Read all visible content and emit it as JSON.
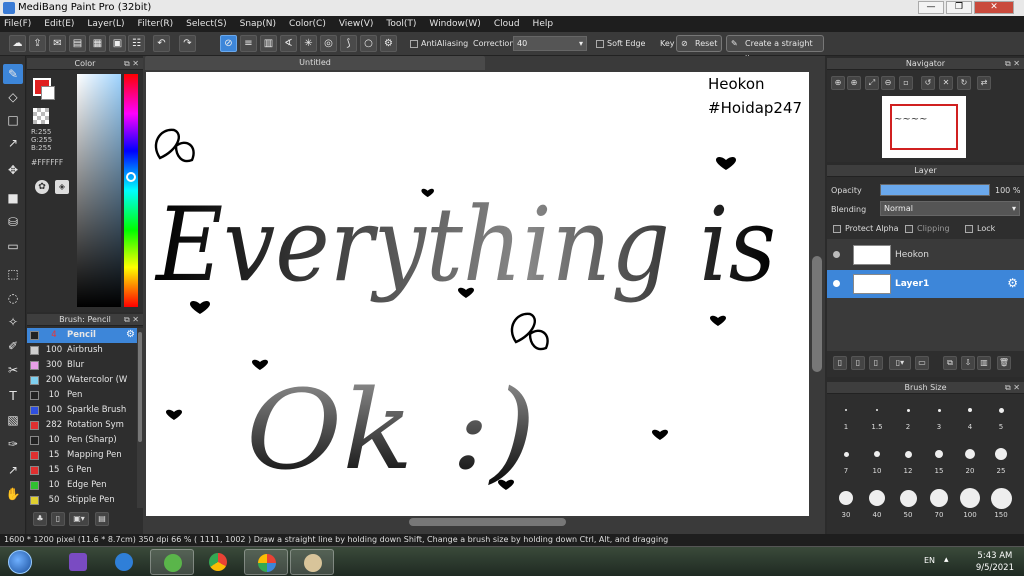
{
  "window": {
    "title": "MediBang Paint Pro (32bit)",
    "min": "—",
    "max": "❐",
    "close": "✕"
  },
  "menu": [
    "File(F)",
    "Edit(E)",
    "Layer(L)",
    "Filter(R)",
    "Select(S)",
    "Snap(N)",
    "Color(C)",
    "View(V)",
    "Tool(T)",
    "Window(W)",
    "Cloud",
    "Help"
  ],
  "toolbar": {
    "antialiasing_label": "AntiAliasing",
    "correction_label": "Correction",
    "correction_value": "40",
    "soft_edge_label": "Soft Edge",
    "key_label": "Key",
    "reset_label": "Reset",
    "straight_line_label": "Create a straight line"
  },
  "color_panel": {
    "title": "Color",
    "r": "R:255",
    "g": "G:255",
    "b": "B:255",
    "hex": "#FFFFFF",
    "primary_color": "#e02020",
    "secondary_color": "#ffffff"
  },
  "brush_panel": {
    "title": "Brush: Pencil",
    "brushes": [
      {
        "size": "4",
        "name": "Pencil",
        "color": "#222222",
        "selected": true
      },
      {
        "size": "100",
        "name": "Airbrush",
        "color": "#cfcfcf"
      },
      {
        "size": "300",
        "name": "Blur",
        "color": "#e6a0e6"
      },
      {
        "size": "200",
        "name": "Watercolor (W",
        "color": "#7fd0f0"
      },
      {
        "size": "10",
        "name": "Pen",
        "color": "#222222"
      },
      {
        "size": "100",
        "name": "Sparkle Brush",
        "color": "#3050e0"
      },
      {
        "size": "282",
        "name": "Rotation Sym",
        "color": "#e03030"
      },
      {
        "size": "10",
        "name": "Pen (Sharp)",
        "color": "#222222"
      },
      {
        "size": "15",
        "name": "Mapping Pen",
        "color": "#e03030"
      },
      {
        "size": "15",
        "name": "G Pen",
        "color": "#e03030"
      },
      {
        "size": "10",
        "name": "Edge Pen",
        "color": "#30c030"
      },
      {
        "size": "50",
        "name": "Stipple Pen",
        "color": "#e0d030"
      }
    ]
  },
  "document": {
    "tab": "Untitled",
    "artwork_text_main": "Everything is",
    "artwork_text_second": "Ok :)",
    "watermark_line1": "Heokon",
    "watermark_line2": "#Hoidap247"
  },
  "navigator": {
    "title": "Navigator"
  },
  "layer_panel": {
    "title": "Layer",
    "opacity_label": "Opacity",
    "opacity_value": "100 %",
    "opacity_fraction": 1.0,
    "blending_label": "Blending",
    "blending_value": "Normal",
    "protect_alpha": "Protect Alpha",
    "clipping": "Clipping",
    "lock": "Lock",
    "layers": [
      {
        "name": "Heokon",
        "selected": false
      },
      {
        "name": "Layer1",
        "selected": true
      }
    ]
  },
  "brush_size": {
    "title": "Brush Size",
    "sizes": [
      "1",
      "1.5",
      "2",
      "3",
      "4",
      "5",
      "7",
      "10",
      "12",
      "15",
      "20",
      "25",
      "30",
      "40",
      "50",
      "70",
      "100",
      "150"
    ]
  },
  "status": {
    "text": "1600 * 1200 pixel  (11.6 * 8.7cm)  350 dpi  66 %  ( 1111, 1002 )  Draw a straight line by holding down Shift, Change a brush size by holding down Ctrl, Alt, and dragging"
  },
  "taskbar": {
    "lang": "EN",
    "time": "5:43 AM",
    "date": "9/5/2021"
  },
  "accent": "#3d86d9"
}
